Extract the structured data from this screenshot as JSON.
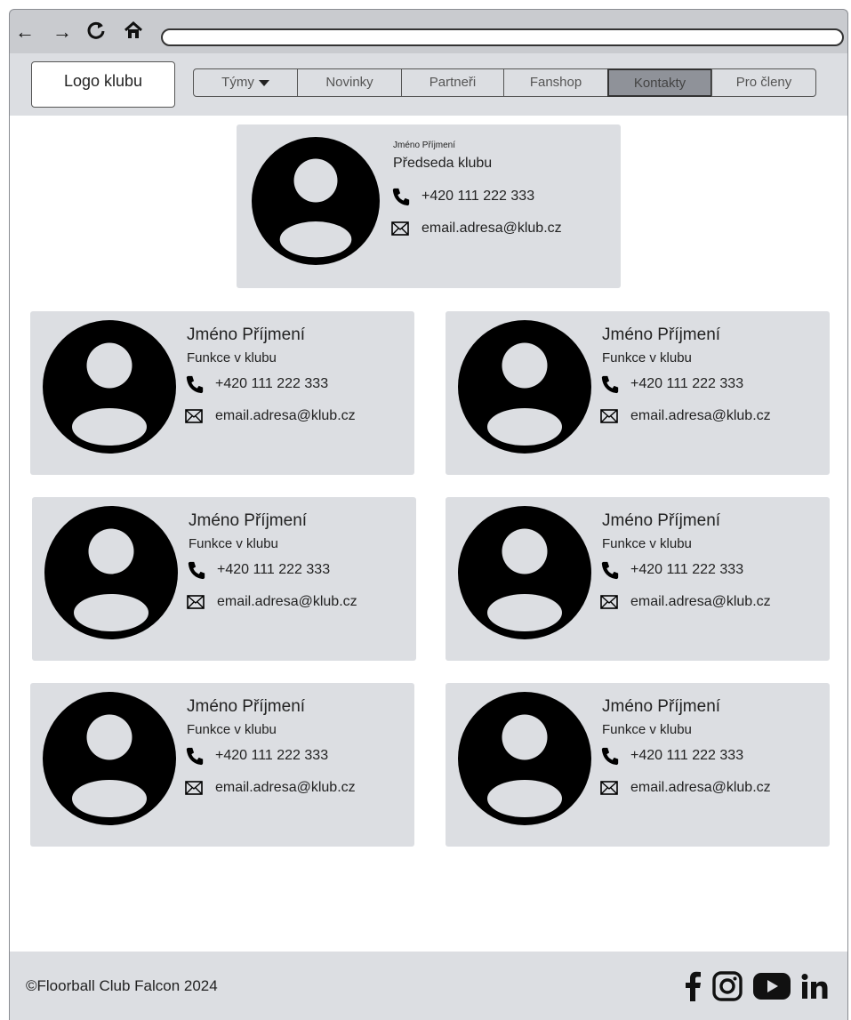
{
  "browser": {
    "back_icon": "arrow-left-icon",
    "forward_icon": "arrow-right-icon",
    "reload_icon": "reload-icon",
    "home_icon": "home-icon",
    "address": ""
  },
  "header": {
    "logo": "Logo klubu",
    "menu": [
      {
        "label": "Týmy",
        "dropdown": true
      },
      {
        "label": "Novinky"
      },
      {
        "label": "Partneři"
      },
      {
        "label": "Fanshop"
      },
      {
        "label": "Kontakty",
        "active": true
      },
      {
        "label": "Pro členy"
      }
    ]
  },
  "featured": {
    "name": "Jméno Příjmení",
    "role": "Předseda klubu",
    "phone": "+420 111 222 333",
    "email": "email.adresa@klub.cz"
  },
  "contacts": [
    {
      "name": "Jméno Příjmení",
      "role": "Funkce v klubu",
      "phone": "+420 111 222 333",
      "email": "email.adresa@klub.cz"
    },
    {
      "name": "Jméno Příjmení",
      "role": "Funkce v klubu",
      "phone": "+420 111 222 333",
      "email": "email.adresa@klub.cz"
    },
    {
      "name": "Jméno Příjmení",
      "role": "Funkce v klubu",
      "phone": "+420 111 222 333",
      "email": "email.adresa@klub.cz"
    },
    {
      "name": "Jméno Příjmení",
      "role": "Funkce v klubu",
      "phone": "+420 111 222 333",
      "email": "email.adresa@klub.cz"
    },
    {
      "name": "Jméno Příjmení",
      "role": "Funkce v klubu",
      "phone": "+420 111 222 333",
      "email": "email.adresa@klub.cz"
    },
    {
      "name": "Jméno Příjmení",
      "role": "Funkce v klubu",
      "phone": "+420 111 222 333",
      "email": "email.adresa@klub.cz"
    }
  ],
  "footer": {
    "copyright": "©Floorball Club Falcon 2024",
    "social": [
      "facebook-icon",
      "instagram-icon",
      "youtube-icon",
      "linkedin-icon"
    ]
  }
}
